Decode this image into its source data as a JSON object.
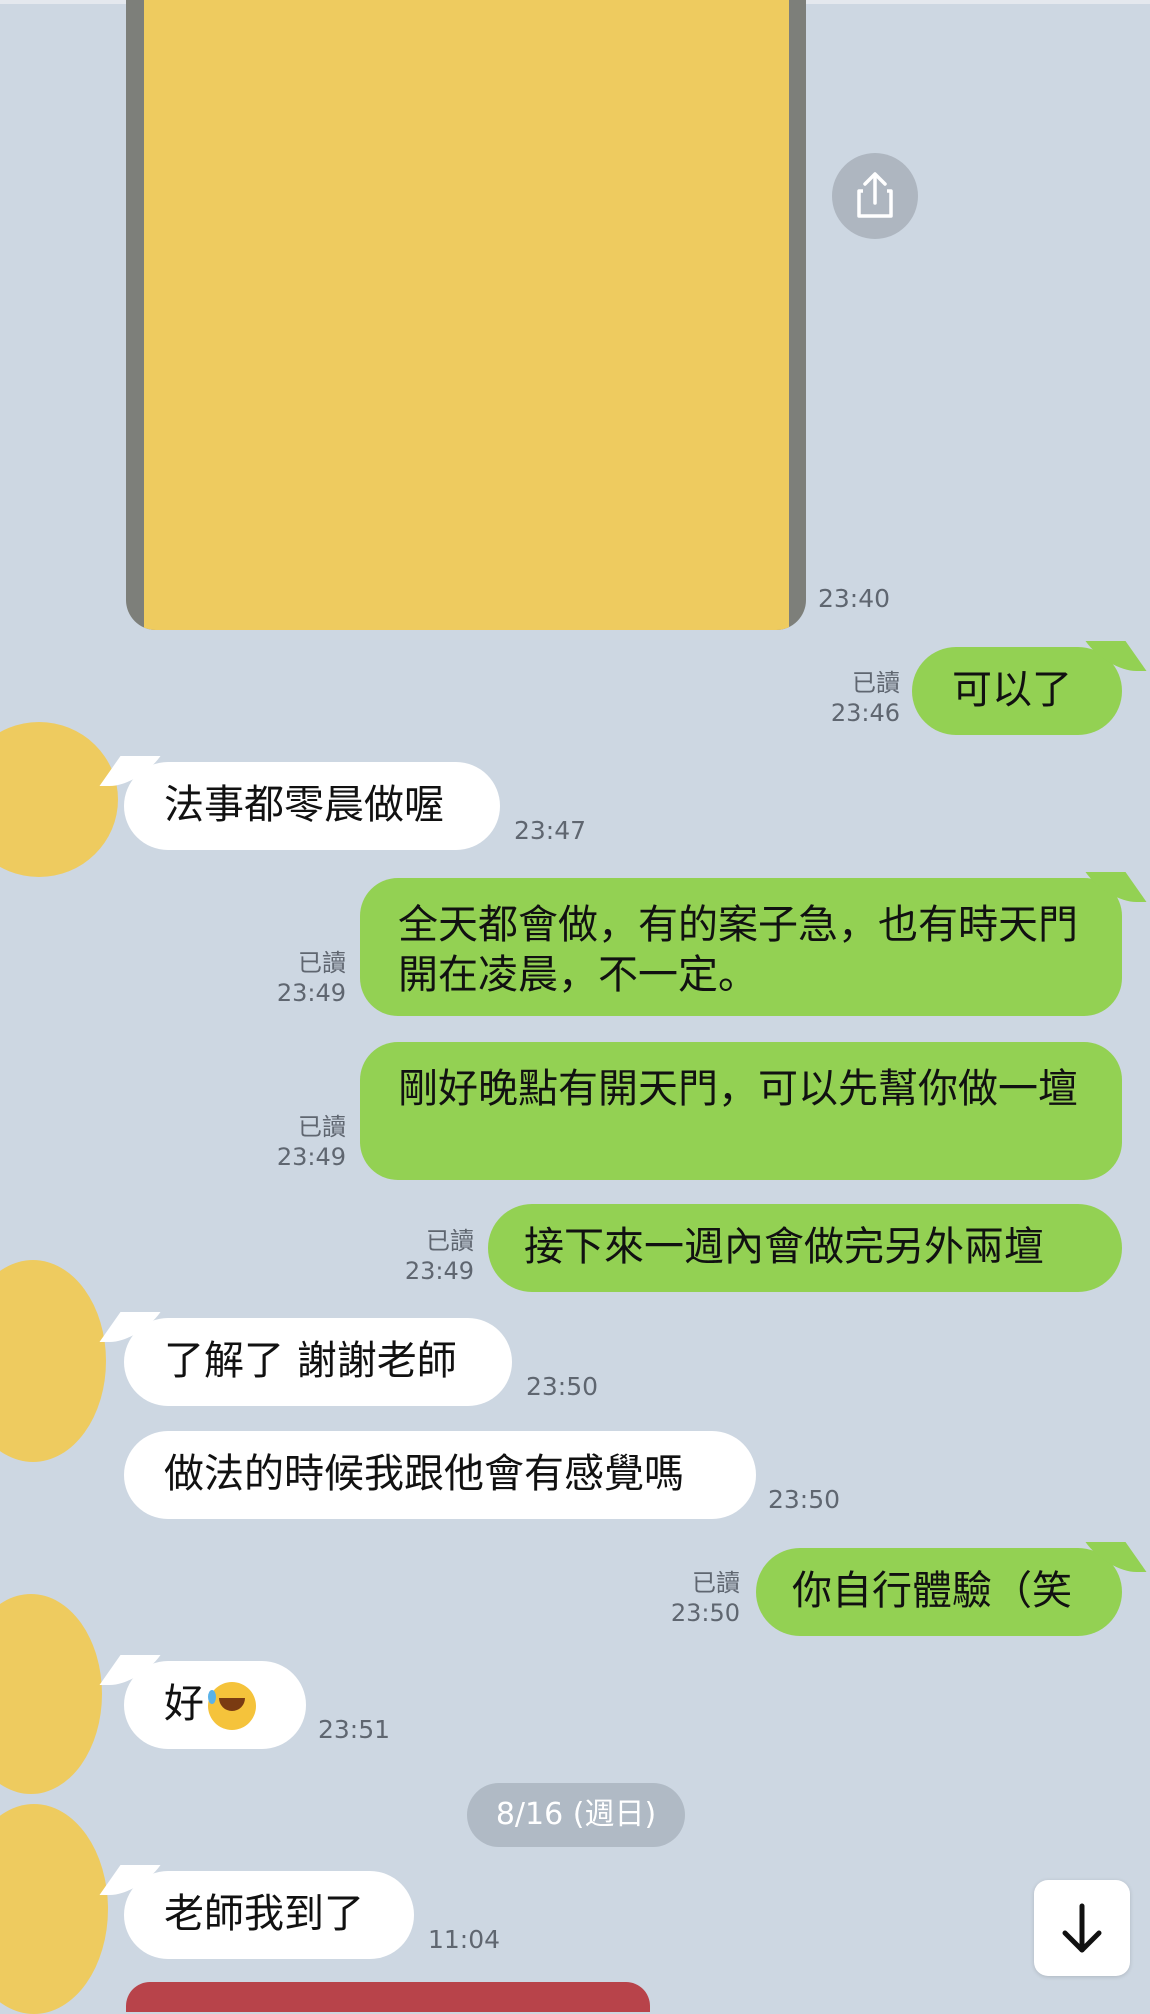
{
  "colors": {
    "background": "#cdd7e2",
    "incoming_bubble": "#ffffff",
    "outgoing_bubble": "#93d153",
    "avatar_placeholder": "#eecb5f",
    "image_placeholder": "#eecb5f"
  },
  "messages": {
    "m0_image_time": "23:40",
    "m1": {
      "text": "可以了",
      "read": "已讀",
      "time": "23:46"
    },
    "m2": {
      "text": "法事都零晨做喔",
      "time": "23:47"
    },
    "m3": {
      "text": "全天都會做，有的案子急，也有時天門開在凌晨，不一定。",
      "read": "已讀",
      "time": "23:49"
    },
    "m4": {
      "text": "剛好晚點有開天門，可以先幫你做一壇",
      "read": "已讀",
      "time": "23:49"
    },
    "m5": {
      "text": "接下來一週內會做完另外兩壇",
      "read": "已讀",
      "time": "23:49"
    },
    "m6": {
      "text": "了解了 謝謝老師",
      "time": "23:50"
    },
    "m7": {
      "text": "做法的時候我跟他會有感覺嗎",
      "time": "23:50"
    },
    "m8": {
      "text": "你自行體驗（笑",
      "read": "已讀",
      "time": "23:50"
    },
    "m9": {
      "text": "好",
      "emoji": "rolling-on-floor-laughing-emoji",
      "time": "23:51"
    },
    "date_separator": "8/16 (週日)",
    "m10": {
      "text": "老師我到了",
      "time": "11:04"
    }
  },
  "icons": {
    "share": "share-icon",
    "scroll_down": "arrow-down-icon"
  }
}
